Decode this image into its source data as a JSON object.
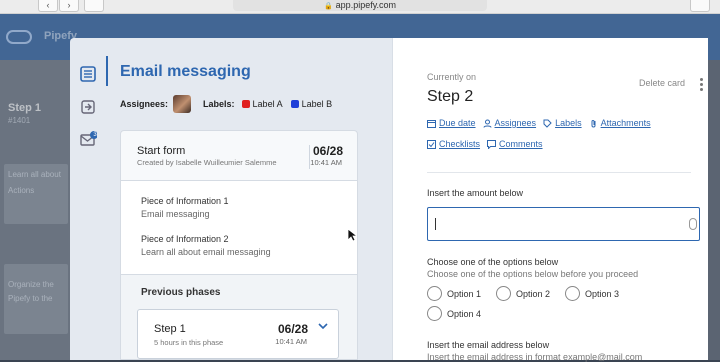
{
  "browser": {
    "url": "app.pipefy.com"
  },
  "background": {
    "app_text": "Pipefy",
    "list_title": "Step 1",
    "list_sub": "#1401",
    "card_text_1": "Learn all about",
    "card_text_2": "Actions",
    "card_text_3": "Organize the",
    "card_text_4": "Pipefy to the"
  },
  "card": {
    "title": "Email messaging",
    "assignees_label": "Assignees:",
    "labels_label": "Labels:",
    "labels": [
      {
        "name": "Label A",
        "color": "#e02020"
      },
      {
        "name": "Label B",
        "color": "#1f3fd8"
      }
    ],
    "attachments_badge": "3"
  },
  "start_form": {
    "title": "Start form",
    "created_by": "Created by Isabelle Wuilleumier Salemme",
    "date": "06/28",
    "time": "10:41 AM",
    "fields": [
      {
        "label": "Piece of Information 1",
        "value": "Email messaging"
      },
      {
        "label": "Piece of Information 2",
        "value": "Learn all about email messaging"
      }
    ]
  },
  "previous_phases": {
    "title": "Previous phases",
    "items": [
      {
        "name": "Step 1",
        "duration": "5 hours in this phase",
        "date": "06/28",
        "time": "10:41 AM"
      }
    ]
  },
  "current_phase": {
    "currently_on": "Currently on",
    "name": "Step 2",
    "delete_label": "Delete card",
    "actions": {
      "due_date": "Due date",
      "assignees": "Assignees",
      "labels": "Labels",
      "attachments": "Attachments",
      "checklists": "Checklists",
      "comments": "Comments"
    },
    "amount_field": {
      "label": "Insert the amount below",
      "value": ""
    },
    "options_field": {
      "label": "Choose one of the options below",
      "help": "Choose one of the options below before you proceed",
      "options": [
        "Option 1",
        "Option 2",
        "Option 3",
        "Option 4"
      ]
    },
    "email_field": {
      "label": "Insert the email address below",
      "help": "Insert the email address in format example@mail.com"
    }
  },
  "colors": {
    "accent": "#2e67b0",
    "overlay": "#5b6472"
  }
}
